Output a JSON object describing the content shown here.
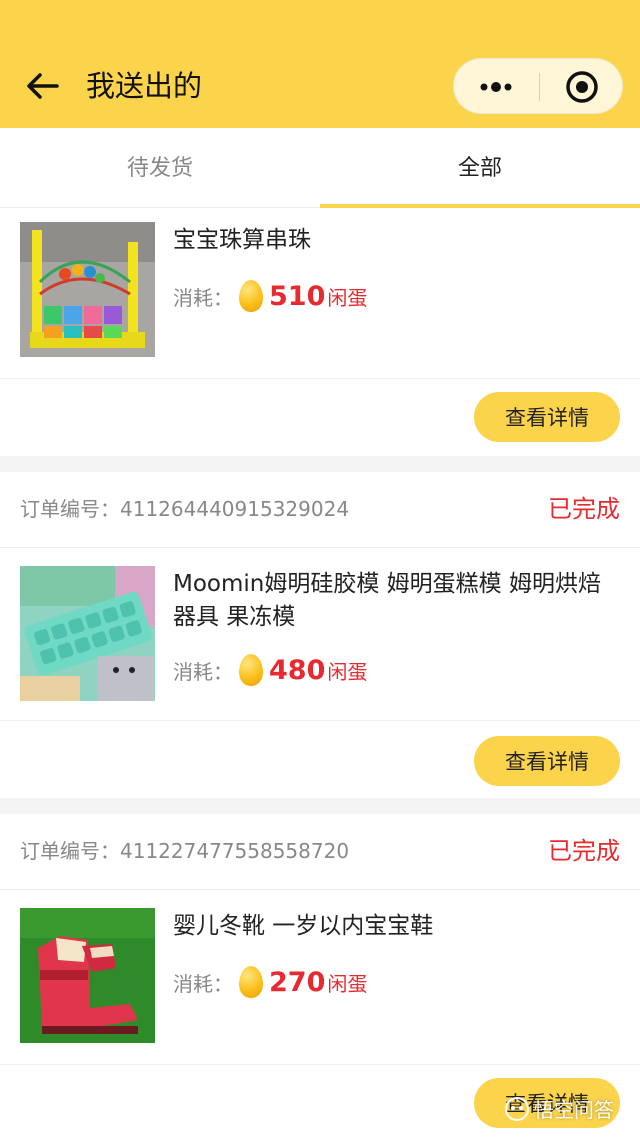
{
  "header": {
    "title": "我送出的",
    "back_icon": "back-arrow-icon",
    "more_icon": "more-dots-icon",
    "close_icon": "target-close-icon",
    "bg_color": "#fcd44c"
  },
  "tabs": [
    {
      "label": "待发货",
      "active": false
    },
    {
      "label": "全部",
      "active": true
    }
  ],
  "orders": [
    {
      "order_no_label": "",
      "order_no": "",
      "status": "",
      "product_name": "宝宝珠算串珠",
      "cost_label": "消耗：",
      "price": "510",
      "unit": "闲蛋",
      "detail_button": "查看详情"
    },
    {
      "order_no_label": "订单编号：",
      "order_no": "411264440915329024",
      "status": "已完成",
      "product_name": "Moomin姆明硅胶模 姆明蛋糕模 姆明烘焙器具 果冻模",
      "cost_label": "消耗：",
      "price": "480",
      "unit": "闲蛋",
      "detail_button": "查看详情"
    },
    {
      "order_no_label": "订单编号：",
      "order_no": "411227477558558720",
      "status": "已完成",
      "product_name": "婴儿冬靴 一岁以内宝宝鞋",
      "cost_label": "消耗：",
      "price": "270",
      "unit": "闲蛋",
      "detail_button": "查看详情"
    }
  ],
  "watermark": "悟空问答",
  "colors": {
    "accent": "#fcd44c",
    "price": "#e8292f",
    "status": "#e8292f"
  }
}
